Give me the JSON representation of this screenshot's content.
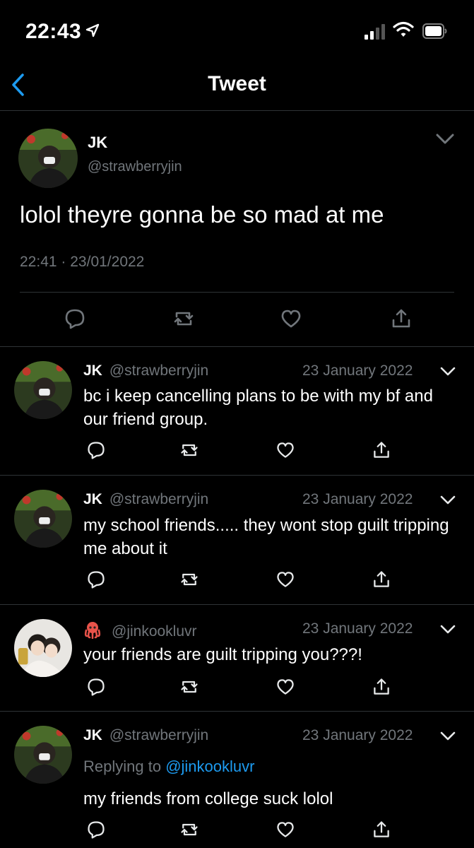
{
  "status_bar": {
    "time": "22:43",
    "icons": [
      "location-arrow-icon",
      "signal-icon",
      "wifi-icon",
      "battery-icon"
    ]
  },
  "nav": {
    "title": "Tweet",
    "back_icon": "chevron-left-icon"
  },
  "main_tweet": {
    "name": "JK",
    "handle": "@strawberryjin",
    "text": "lolol theyre gonna be so mad at me",
    "time": "22:41",
    "separator": "·",
    "date": "23/01/2022",
    "actions": [
      "reply-icon",
      "retweet-icon",
      "like-icon",
      "share-icon"
    ]
  },
  "replies": [
    {
      "name": "JK",
      "handle": "@strawberryjin",
      "date": "23 January 2022",
      "text": "bc i keep cancelling plans to be with my bf and our friend group."
    },
    {
      "name": "JK",
      "handle": "@strawberryjin",
      "date": "23 January 2022",
      "text": "my school friends..... they wont stop guilt tripping me about it"
    },
    {
      "name": "🐙",
      "handle": "@jinkookluvr",
      "date": "23 January 2022",
      "text": "your friends are guilt tripping you???!"
    },
    {
      "name": "JK",
      "handle": "@strawberryjin",
      "date": "23 January 2022",
      "replying_prefix": "Replying to",
      "replying_to": "@jinkookluvr",
      "text": "my friends from college suck lolol"
    }
  ],
  "colors": {
    "background": "#000000",
    "text": "#ffffff",
    "secondary": "#71767b",
    "accent": "#1d9bf0",
    "divider": "#2f3336"
  }
}
